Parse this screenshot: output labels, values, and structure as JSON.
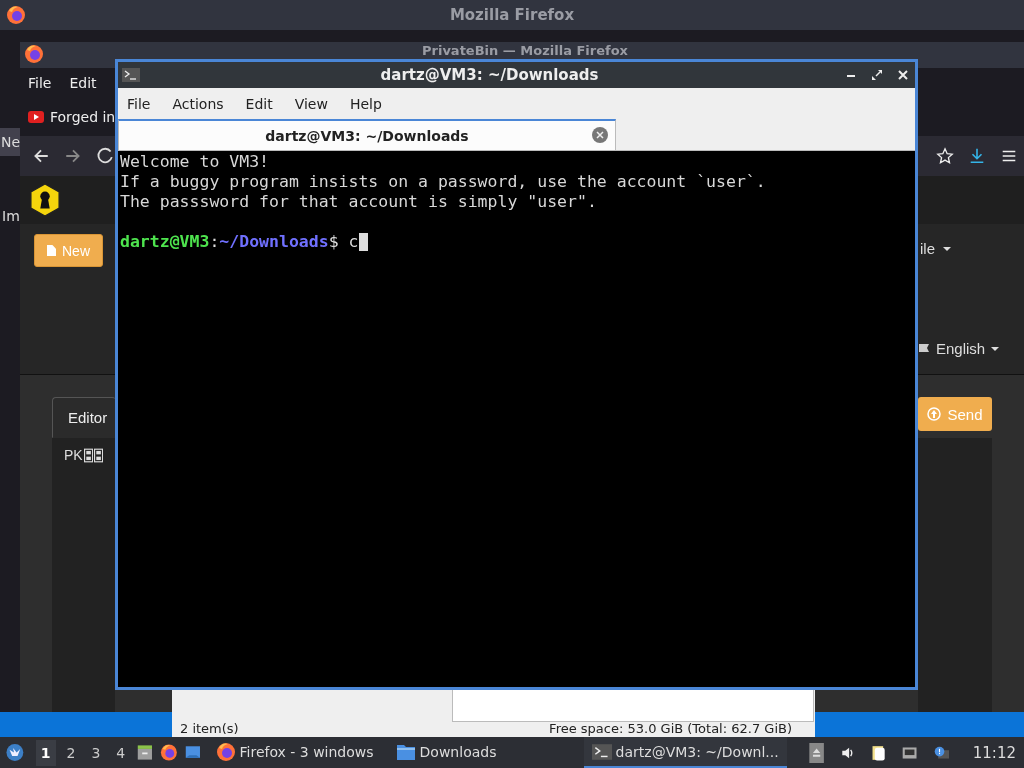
{
  "back_window": {
    "title": "Mozilla Firefox",
    "edge_texts": [
      "Ne",
      "Im"
    ]
  },
  "browser": {
    "title": "PrivateBin — Mozilla Firefox",
    "menu": [
      "File",
      "Edit"
    ],
    "bookmark": "Forged in",
    "page": {
      "new_button": "New",
      "file_button": "ile",
      "language": "English",
      "tabs": [
        {
          "label": "Editor",
          "selected": true
        }
      ],
      "send_button": "Send",
      "editor_text": "PK"
    }
  },
  "file_manager": {
    "item_count": "2 item(s)",
    "free_space": "Free space: 53.0 GiB (Total: 62.7 GiB)"
  },
  "terminal": {
    "title": "dartz@VM3: ~/Downloads",
    "menu": [
      "File",
      "Actions",
      "Edit",
      "View",
      "Help"
    ],
    "tabs": [
      {
        "label": "dartz@VM3: ~/Downloads",
        "selected": true
      }
    ],
    "lines": [
      "Welcome to VM3!",
      "If a buggy program insists on a password, use the account `user`.",
      "The passsword for that account is simply \"user\"."
    ],
    "prompt": {
      "user": "dartz@VM3",
      "separator": ":",
      "path": "~/Downloads",
      "symbol": "$",
      "input": "c"
    }
  },
  "taskbar": {
    "workspaces": [
      {
        "label": "1",
        "selected": true
      },
      {
        "label": "2",
        "selected": false
      },
      {
        "label": "3",
        "selected": false
      },
      {
        "label": "4",
        "selected": false
      }
    ],
    "tasks": [
      {
        "label": "Firefox - 3 windows",
        "kind": "firefox",
        "selected": false
      },
      {
        "label": "Downloads",
        "kind": "folder",
        "selected": false
      },
      {
        "label": "dartz@VM3: ~/Downl...",
        "kind": "terminal",
        "selected": true
      }
    ],
    "clock": "11:12"
  }
}
